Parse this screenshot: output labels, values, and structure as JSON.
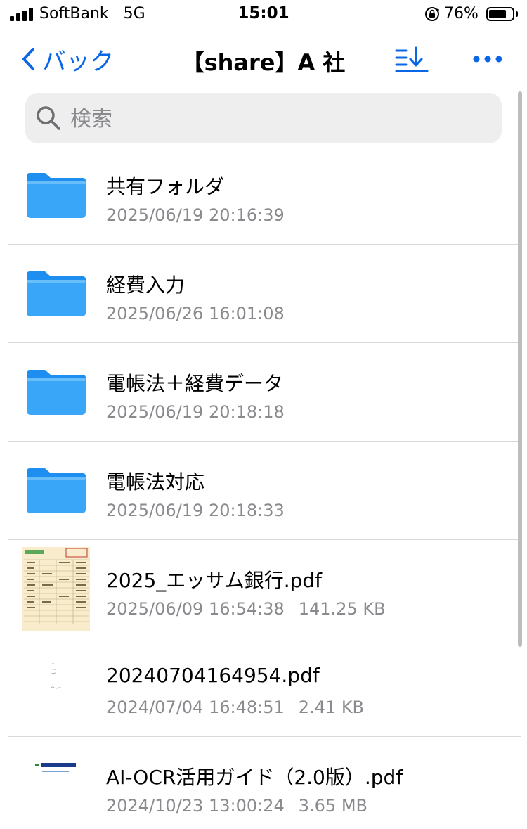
{
  "status_bar": {
    "carrier": "SoftBank",
    "network": "5G",
    "time": "15:01",
    "battery_percent": "76%",
    "battery_level": 0.76
  },
  "nav": {
    "back_label": "バック",
    "title": "【share】A 社",
    "accent_color": "#0a66e6"
  },
  "search": {
    "placeholder": "検索"
  },
  "items": [
    {
      "name": "共有フォルダ",
      "date": "2025/06/19 20:16:39",
      "size": "",
      "type": "folder"
    },
    {
      "name": "経費入力",
      "date": "2025/06/26 16:01:08",
      "size": "",
      "type": "folder"
    },
    {
      "name": "電帳法＋経費データ",
      "date": "2025/06/19 20:18:18",
      "size": "",
      "type": "folder"
    },
    {
      "name": "電帳法対応",
      "date": "2025/06/19 20:18:33",
      "size": "",
      "type": "folder"
    },
    {
      "name": "2025_エッサム銀行.pdf",
      "date": "2025/06/09 16:54:38",
      "size": "141.25 KB",
      "type": "pdf"
    },
    {
      "name": "20240704164954.pdf",
      "date": "2024/07/04 16:48:51",
      "size": "2.41 KB",
      "type": "pdf"
    },
    {
      "name": "AI-OCR活用ガイド（2.0版）.pdf",
      "date": "2024/10/23 13:00:24",
      "size": "3.65 MB",
      "type": "pdf"
    }
  ],
  "icons": {
    "back": "chevron-left-icon",
    "sort": "sort-icon",
    "more": "more-icon",
    "search": "search-icon",
    "folder": "folder-icon",
    "pdf": "pdf-thumbnail"
  }
}
